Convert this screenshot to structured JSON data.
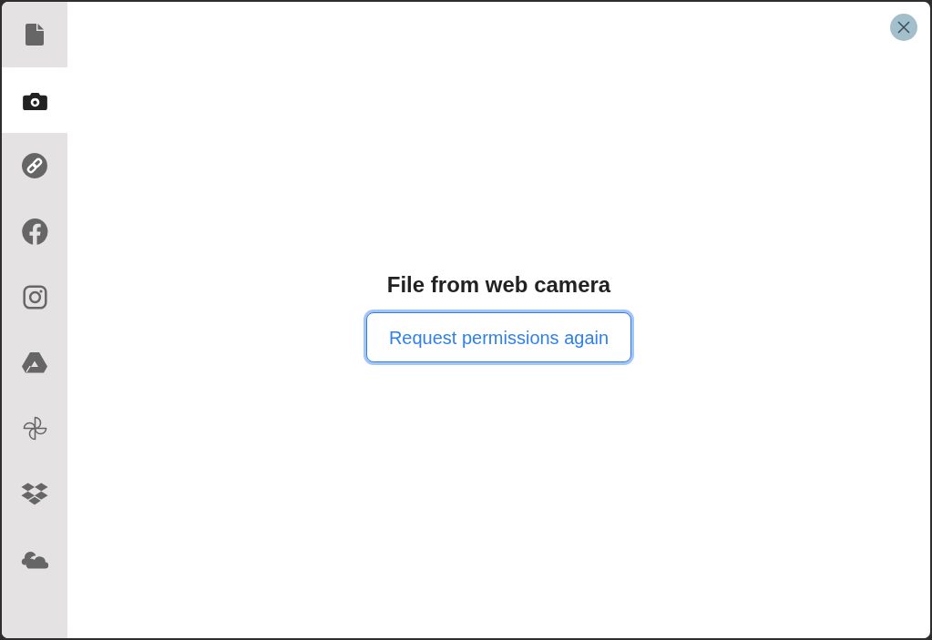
{
  "sidebar": {
    "items": [
      {
        "kind": "file",
        "selected": false
      },
      {
        "kind": "camera",
        "selected": true
      },
      {
        "kind": "link",
        "selected": false
      },
      {
        "kind": "facebook",
        "selected": false
      },
      {
        "kind": "instagram",
        "selected": false
      },
      {
        "kind": "drive",
        "selected": false
      },
      {
        "kind": "photos",
        "selected": false
      },
      {
        "kind": "dropbox",
        "selected": false
      },
      {
        "kind": "onedrive",
        "selected": false
      }
    ]
  },
  "title": "File from web camera",
  "button": {
    "label": "Request permissions again",
    "focused": true
  }
}
